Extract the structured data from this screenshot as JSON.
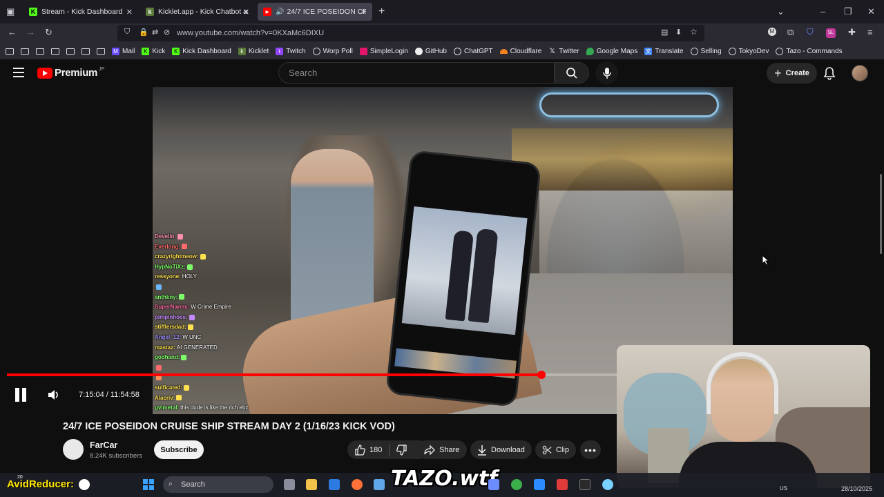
{
  "browser": {
    "tabs": [
      {
        "label": "Stream - Kick Dashboard",
        "favicon": "kick",
        "color": "#53fc18"
      },
      {
        "label": "Kicklet.app - Kick Chatbot and ",
        "favicon": "kicklet",
        "color": "#5c7a3a"
      },
      {
        "label": "24/7 ICE POSEIDON CRUISE",
        "favicon": "youtube",
        "color": "#ff0000",
        "active": true
      }
    ],
    "url": "www.youtube.com/watch?v=0KXaMc6DIXU",
    "bookmarks": [
      "Mail",
      "Kick",
      "Kick Dashboard",
      "Kicklet",
      "Twitch",
      "Worp Poll",
      "SimpleLogin",
      "GitHub",
      "ChatGPT",
      "Cloudflare",
      "Twitter",
      "Google Maps",
      "Translate",
      "Selling",
      "TokyoDev",
      "Tazo - Commands"
    ]
  },
  "youtube": {
    "logo_text": "Premium",
    "logo_region": "JP",
    "search_placeholder": "Search",
    "create_label": "Create"
  },
  "chat": [
    {
      "user": "Develin:",
      "msg": "",
      "color": "#ff8fb1"
    },
    {
      "user": "Everlong:",
      "msg": "",
      "color": "#ff6a6a"
    },
    {
      "user": "crazyrightmeow:",
      "msg": "",
      "color": "#ffe14d"
    },
    {
      "user": "HypNoTiXz:",
      "msg": "",
      "color": "#7dff6a"
    },
    {
      "user": "ressyone:",
      "msg": "HOLY",
      "color": "#ffe14d"
    },
    {
      "user": "",
      "msg": "",
      "color": "#6ab7ff"
    },
    {
      "user": "anthkny:",
      "msg": "",
      "color": "#7dff6a"
    },
    {
      "user": "SuperNarmy:",
      "msg": "W Crime Empire",
      "color": "#ff6aa5"
    },
    {
      "user": "pimpinhoes:",
      "msg": "",
      "color": "#c38bff"
    },
    {
      "user": "stifflersdad:",
      "msg": "",
      "color": "#ffe14d"
    },
    {
      "user": "Angel_12:",
      "msg": "W UNC",
      "color": "#9c8bff"
    },
    {
      "user": "mastaz:",
      "msg": "AI GENERATED",
      "color": "#ffe14d"
    },
    {
      "user": "godhand:",
      "msg": "",
      "color": "#7dff6a"
    },
    {
      "user": "",
      "msg": "",
      "color": "#ff6a6a"
    },
    {
      "user": "",
      "msg": "",
      "color": "#ff8c5a"
    },
    {
      "user": "suificated:",
      "msg": "",
      "color": "#ffe14d"
    },
    {
      "user": "Alacriv:",
      "msg": "",
      "color": "#ffe14d"
    },
    {
      "user": "gvimetal:",
      "msg": "this dude is like the rich ebz",
      "color": "#7dff6a"
    }
  ],
  "player": {
    "time": "7:15:04 / 11:54:58",
    "progress_fraction": 0.876
  },
  "video": {
    "title": "24/7 ICE POSEIDON CRUISE SHIP STREAM DAY 2 (1/16/23 KICK VOD)",
    "channel": "FarCar",
    "subscribers": "8.24K subscribers",
    "subscribe_label": "Subscribe",
    "likes": "180",
    "share_label": "Share",
    "download_label": "Download",
    "clip_label": "Clip"
  },
  "taskbar": {
    "overlay_text": "AvidReducer:",
    "overlay_small": "20",
    "search_label": "Search",
    "brand_overlay": "TAZO.wtf",
    "lang": "US",
    "date": "28/10/2025"
  }
}
